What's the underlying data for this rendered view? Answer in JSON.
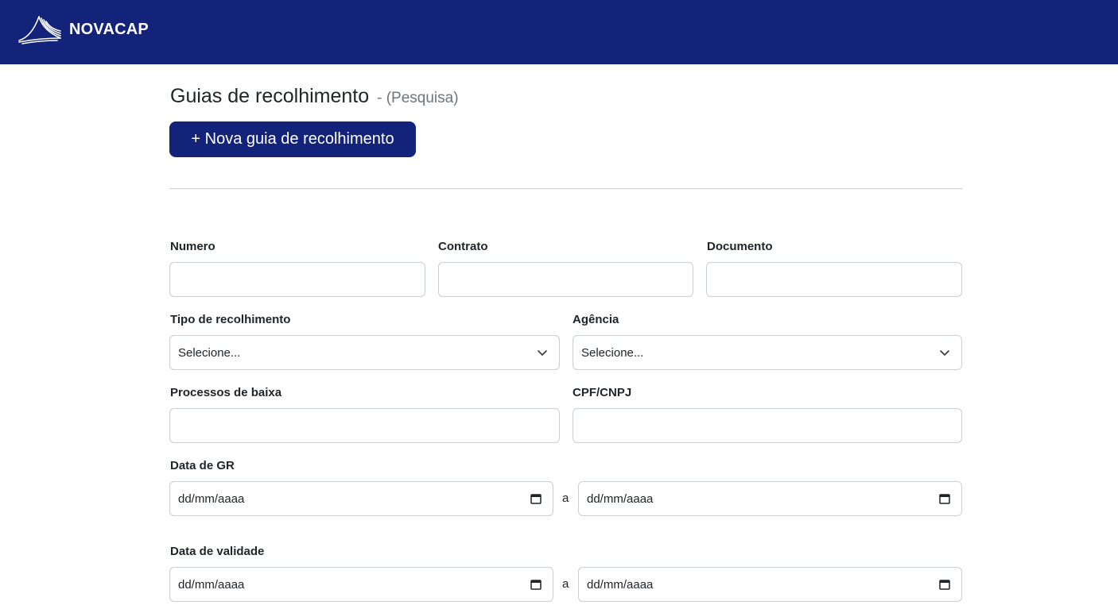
{
  "header": {
    "brand": "NOVACAP"
  },
  "page": {
    "title": "Guias de recolhimento",
    "subtitle": "- (Pesquisa)",
    "new_button": "+ Nova guia de recolhimento"
  },
  "form": {
    "numero": {
      "label": "Numero",
      "value": ""
    },
    "contrato": {
      "label": "Contrato",
      "value": ""
    },
    "documento": {
      "label": "Documento",
      "value": ""
    },
    "tipo_recolhimento": {
      "label": "Tipo de recolhimento",
      "selected": "Selecione..."
    },
    "agencia": {
      "label": "Agência",
      "selected": "Selecione..."
    },
    "processos_baixa": {
      "label": "Processos de baixa",
      "value": ""
    },
    "cpf_cnpj": {
      "label": "CPF/CNPJ",
      "value": ""
    },
    "data_gr": {
      "label": "Data de GR",
      "from": "dd/mm/aaaa",
      "separator": "a",
      "to": "dd/mm/aaaa"
    },
    "data_validade": {
      "label": "Data de validade",
      "from": "dd/mm/aaaa",
      "separator": "a",
      "to": "dd/mm/aaaa"
    }
  },
  "icons": {
    "logo": "novacap-logo",
    "select": "chevron-down-icon",
    "date": "calendar-icon"
  },
  "colors": {
    "primary": "#13237a",
    "border": "#c9ced4",
    "muted": "#6c757d"
  }
}
